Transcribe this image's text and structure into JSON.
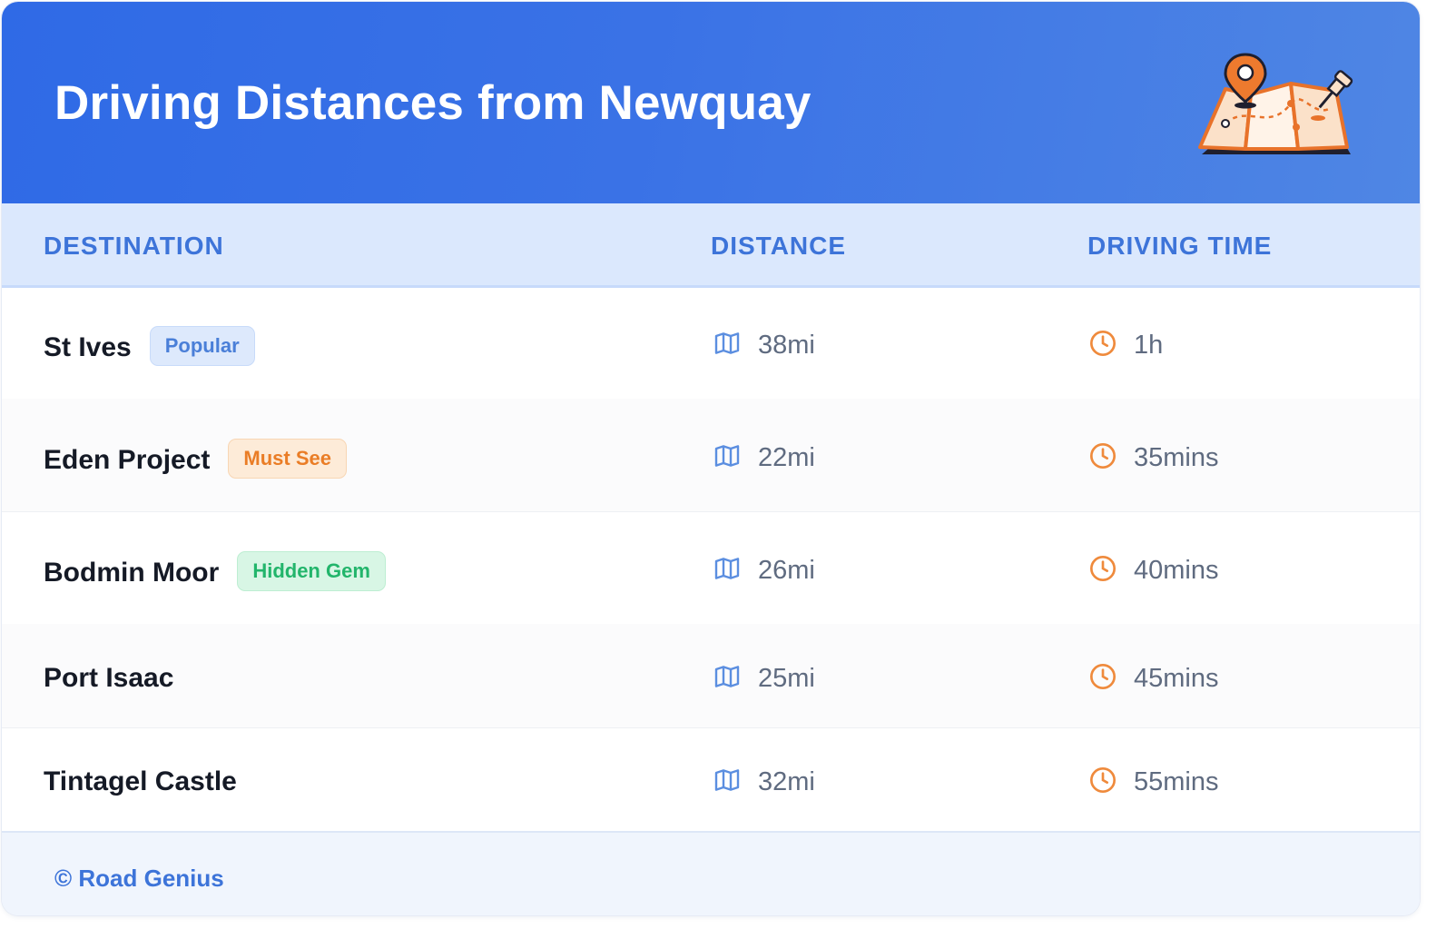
{
  "header": {
    "title": "Driving Distances from Newquay",
    "illustration": "folded-map-with-location-pin-icon"
  },
  "columns": {
    "destination": "DESTINATION",
    "distance": "DISTANCE",
    "driving_time": "DRIVING TIME"
  },
  "rows": [
    {
      "destination": "St Ives",
      "badge": "Popular",
      "distance": "38mi",
      "time": "1h"
    },
    {
      "destination": "Eden Project",
      "badge": "Must See",
      "distance": "22mi",
      "time": "35mins"
    },
    {
      "destination": "Bodmin Moor",
      "badge": "Hidden Gem",
      "distance": "26mi",
      "time": "40mins"
    },
    {
      "destination": "Port Isaac",
      "distance": "25mi",
      "time": "45mins"
    },
    {
      "destination": "Tintagel Castle",
      "distance": "32mi",
      "time": "55mins"
    }
  ],
  "icons": {
    "distance": "map-icon",
    "time": "clock-icon"
  },
  "footer": {
    "credit": "© Road Genius"
  },
  "colors": {
    "header_start": "#2f6ae6",
    "header_end": "#4f86e4",
    "accent_blue": "#3d74d9",
    "accent_orange": "#ea7d26",
    "accent_green": "#22b56b"
  }
}
